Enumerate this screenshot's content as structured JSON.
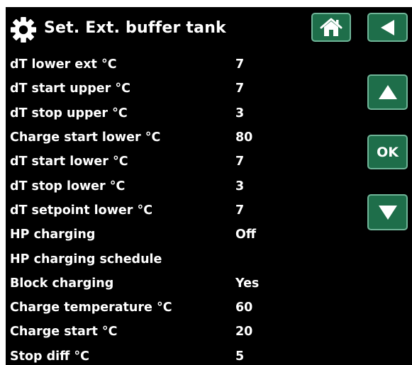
{
  "header": {
    "title": "Set. Ext. buffer tank",
    "icon": "gear-icon"
  },
  "buttons": {
    "home_icon": "home-icon",
    "back_icon": "back-arrow-icon",
    "up_icon": "up-arrow-icon",
    "ok_label": "OK",
    "down_icon": "down-arrow-icon"
  },
  "colors": {
    "background": "#000000",
    "button_fill": "#1e6e4a",
    "button_border": "#6fb598",
    "text": "#ffffff"
  },
  "settings": [
    {
      "label": "dT lower ext °C",
      "value": "7"
    },
    {
      "label": "dT start upper °C",
      "value": "7"
    },
    {
      "label": "dT stop upper °C",
      "value": "3"
    },
    {
      "label": "Charge start lower °C",
      "value": "80"
    },
    {
      "label": "dT start lower °C",
      "value": "7"
    },
    {
      "label": "dT stop lower °C",
      "value": "3"
    },
    {
      "label": "dT setpoint lower °C",
      "value": "7"
    },
    {
      "label": "HP charging",
      "value": "Off"
    },
    {
      "label": "HP charging schedule",
      "value": ""
    },
    {
      "label": "Block charging",
      "value": "Yes"
    },
    {
      "label": "Charge temperature °C",
      "value": "60"
    },
    {
      "label": "Charge start °C",
      "value": "20"
    },
    {
      "label": "Stop diff °C",
      "value": "5"
    }
  ]
}
